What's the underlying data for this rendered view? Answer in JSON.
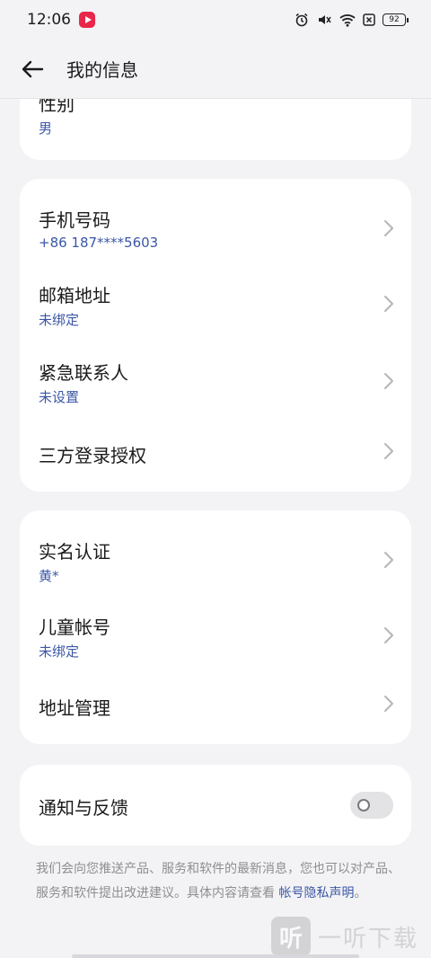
{
  "status": {
    "time": "12:06",
    "battery": "92"
  },
  "header": {
    "title": "我的信息"
  },
  "gender": {
    "label": "性别",
    "value": "男"
  },
  "account": {
    "phone": {
      "label": "手机号码",
      "value": "+86 187****5603"
    },
    "email": {
      "label": "邮箱地址",
      "value": "未绑定"
    },
    "emergency": {
      "label": "紧急联系人",
      "value": "未设置"
    },
    "thirdparty": {
      "label": "三方登录授权"
    }
  },
  "identity": {
    "realname": {
      "label": "实名认证",
      "value": "黄*"
    },
    "child": {
      "label": "儿童帐号",
      "value": "未绑定"
    },
    "address": {
      "label": "地址管理"
    }
  },
  "notify": {
    "label": "通知与反馈",
    "enabled": false
  },
  "footnote": {
    "line1": "我们会向您推送产品、服务和软件的最新消息，您也可以对产品、服务和软件提出改进建议。具体内容请查看",
    "link": "帐号隐私声明",
    "tail": "。"
  },
  "watermark": {
    "logo": "听",
    "text": "一听下载"
  }
}
